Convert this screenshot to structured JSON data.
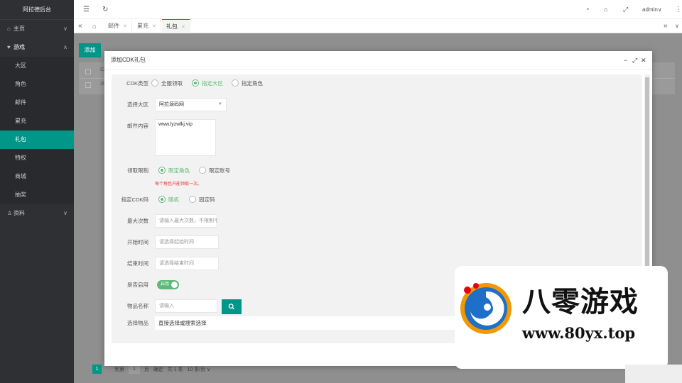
{
  "app": {
    "title": "阿拉德后台"
  },
  "sidebar": {
    "items": [
      {
        "label": "主页"
      },
      {
        "label": "游戏",
        "children": [
          {
            "label": "大区"
          },
          {
            "label": "角色"
          },
          {
            "label": "邮件"
          },
          {
            "label": "累充"
          },
          {
            "label": "礼包",
            "active": true
          },
          {
            "label": "特权"
          },
          {
            "label": "商城"
          },
          {
            "label": "抽奖"
          }
        ]
      },
      {
        "label": "资料"
      }
    ]
  },
  "header": {
    "user": "admin",
    "icons": [
      "menu-icon",
      "refresh-icon",
      "palette-icon",
      "tag-icon",
      "fullscreen-icon",
      "more-icon"
    ]
  },
  "tabs": [
    {
      "label": "邮件"
    },
    {
      "label": "累充"
    },
    {
      "label": "礼包",
      "active": true
    }
  ],
  "content": {
    "add_label": "添加",
    "bg_id": "ID",
    "bg_row": "35"
  },
  "pager": {
    "current": "1",
    "goto": "到第",
    "page": "1",
    "unit": "页",
    "confirm": "确定",
    "total": "共 1 条",
    "per_page": "10 条/页"
  },
  "modal": {
    "title": "添加CDK礼包",
    "cdk_type": {
      "label": "CDK类型",
      "options": [
        "全服领取",
        "指定大区",
        "指定角色"
      ],
      "selected": 1
    },
    "region": {
      "label": "选择大区",
      "value": "阿拉源码网"
    },
    "mail": {
      "label": "邮件内容",
      "value": "www.lyzwlkj.vip"
    },
    "limit": {
      "label": "领取限制",
      "options": [
        "限定角色",
        "限定账号"
      ],
      "selected": 0,
      "hint": "每个角色只能领取一次。"
    },
    "cdk_code": {
      "label": "指定CDK码",
      "options": [
        "随机",
        "固定码"
      ],
      "selected": 0
    },
    "max_times": {
      "label": "最大次数",
      "placeholder": "请输入最大次数，不限制不填"
    },
    "start_time": {
      "label": "开始时间",
      "placeholder": "请选择起始时间"
    },
    "end_time": {
      "label": "结束时间",
      "placeholder": "请选择结束时间"
    },
    "enabled": {
      "label": "是否启用",
      "value": "启用"
    },
    "item_name": {
      "label": "物品名称",
      "placeholder": "请输入"
    },
    "item_select": {
      "label": "选择物品",
      "value": "直接选择或搜索选择"
    }
  },
  "watermark": {
    "title": "八零游戏",
    "url": "www.80yx.top",
    "colors": [
      "#f39800",
      "#1e6fc7",
      "#e60012"
    ]
  }
}
